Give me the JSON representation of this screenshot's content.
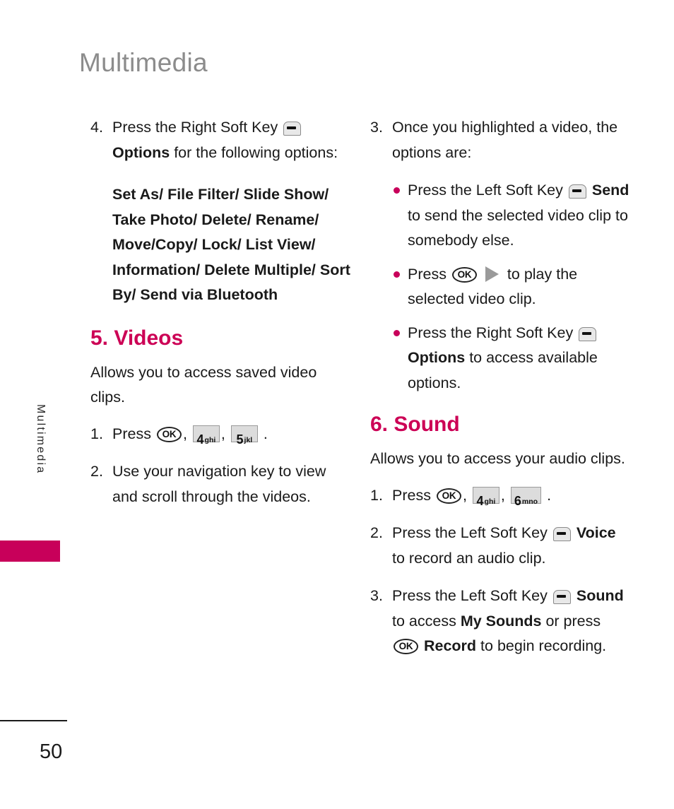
{
  "page": {
    "header_title": "Multimedia",
    "side_tab_label": "Multimedia",
    "page_number": "50",
    "accent_color": "#cc0055",
    "header_color": "#8c8c8c"
  },
  "icons": {
    "soft_key": "soft-key-icon",
    "ok_key_label": "OK",
    "play": "play-triangle-icon",
    "key_4": {
      "digit": "4",
      "letters": "ghi"
    },
    "key_5": {
      "digit": "5",
      "letters": "jkl"
    },
    "key_6": {
      "digit": "6",
      "letters": "mno"
    }
  },
  "left_column": {
    "step4": {
      "number": "4.",
      "text_a": "Press the Right Soft Key",
      "bold_b": "Options",
      "text_c": "for the following options:"
    },
    "options_list": "Set As/ File Filter/ Slide Show/ Take Photo/ Delete/ Rename/ Move/Copy/ Lock/ List View/ Information/ Delete Multiple/ Sort By/ Send via Bluetooth",
    "videos": {
      "heading": "5. Videos",
      "intro": "Allows you to access saved video clips.",
      "step1": {
        "number": "1.",
        "text_a": "Press",
        "sep1": ",",
        "sep2": ",",
        "end": "."
      },
      "step2": {
        "number": "2.",
        "text": "Use your navigation key to view and scroll through the videos."
      }
    }
  },
  "right_column": {
    "step3": {
      "number": "3.",
      "text": "Once you highlighted a video, the options are:"
    },
    "bullets": [
      {
        "text_a": "Press the Left Soft Key",
        "bold_b": "Send",
        "text_c": "to send the selected video clip to somebody else."
      },
      {
        "text_a": "Press",
        "text_c": "to play the selected video clip."
      },
      {
        "text_a": "Press the Right Soft Key",
        "bold_b": "Options",
        "text_c": "to access available options."
      }
    ],
    "sound": {
      "heading": "6. Sound",
      "intro": "Allows you to access your audio clips.",
      "step1": {
        "number": "1.",
        "text_a": "Press",
        "sep1": ",",
        "sep2": ",",
        "end": "."
      },
      "step2": {
        "number": "2.",
        "text_a": "Press the Left Soft Key",
        "bold_b": "Voice",
        "text_c": "to record an audio clip."
      },
      "step3": {
        "number": "3.",
        "text_a": "Press the Left Soft Key",
        "bold_b": "Sound",
        "text_c": "to access",
        "bold_d": "My Sounds",
        "text_e": "or press",
        "bold_f": "Record",
        "text_g": "to begin recording."
      }
    }
  }
}
